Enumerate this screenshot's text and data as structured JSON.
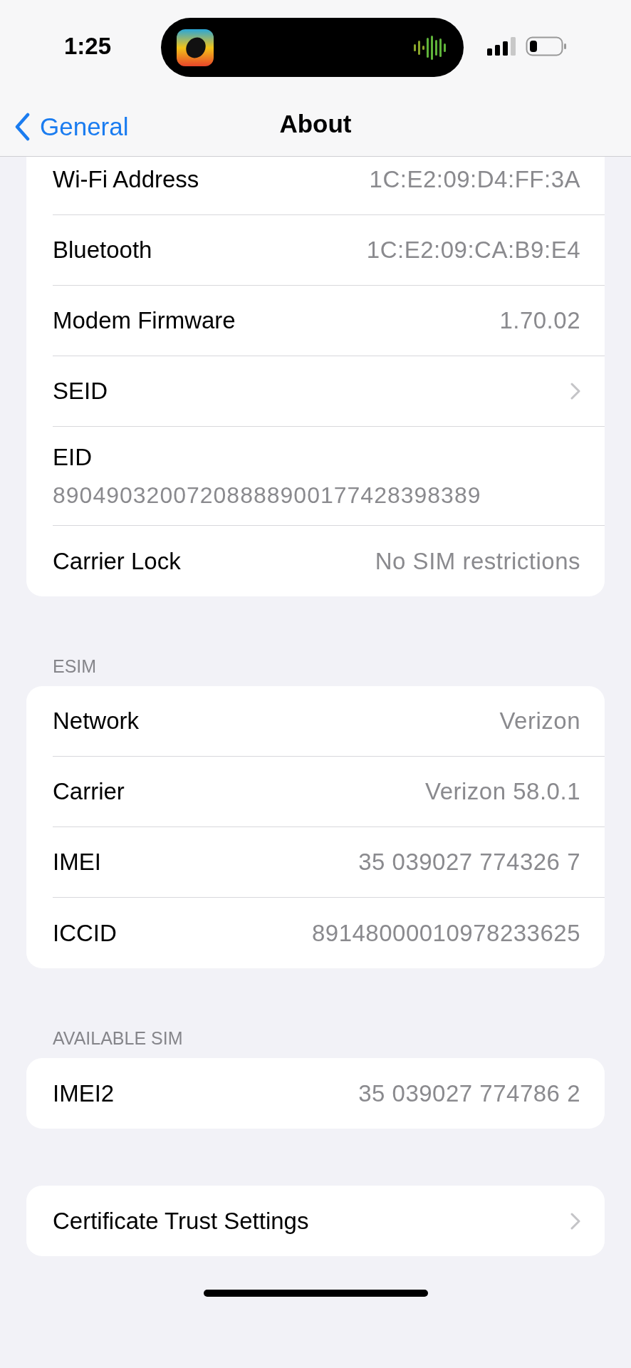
{
  "status_bar": {
    "time": "1:25"
  },
  "nav": {
    "back": "General",
    "title": "About"
  },
  "groups": [
    {
      "rows": [
        {
          "kind": "value",
          "label": "Wi-Fi Address",
          "value": "1C:E2:09:D4:FF:3A"
        },
        {
          "kind": "value",
          "label": "Bluetooth",
          "value": "1C:E2:09:CA:B9:E4"
        },
        {
          "kind": "value",
          "label": "Modem Firmware",
          "value": "1.70.02"
        },
        {
          "kind": "link",
          "label": "SEID"
        },
        {
          "kind": "stacked",
          "label": "EID",
          "value": "89049032007208888900177428398389"
        },
        {
          "kind": "value",
          "label": "Carrier Lock",
          "value": "No SIM restrictions"
        }
      ]
    },
    {
      "header": "ESIM",
      "rows": [
        {
          "kind": "value",
          "label": "Network",
          "value": "Verizon"
        },
        {
          "kind": "value",
          "label": "Carrier",
          "value": "Verizon 58.0.1"
        },
        {
          "kind": "value",
          "label": "IMEI",
          "value": "35 039027 774326 7"
        },
        {
          "kind": "value",
          "label": "ICCID",
          "value": "89148000010978233625"
        }
      ]
    },
    {
      "header": "AVAILABLE SIM",
      "rows": [
        {
          "kind": "value",
          "label": "IMEI2",
          "value": "35 039027 774786 2"
        }
      ]
    },
    {
      "rows": [
        {
          "kind": "link",
          "label": "Certificate Trust Settings"
        }
      ]
    }
  ]
}
